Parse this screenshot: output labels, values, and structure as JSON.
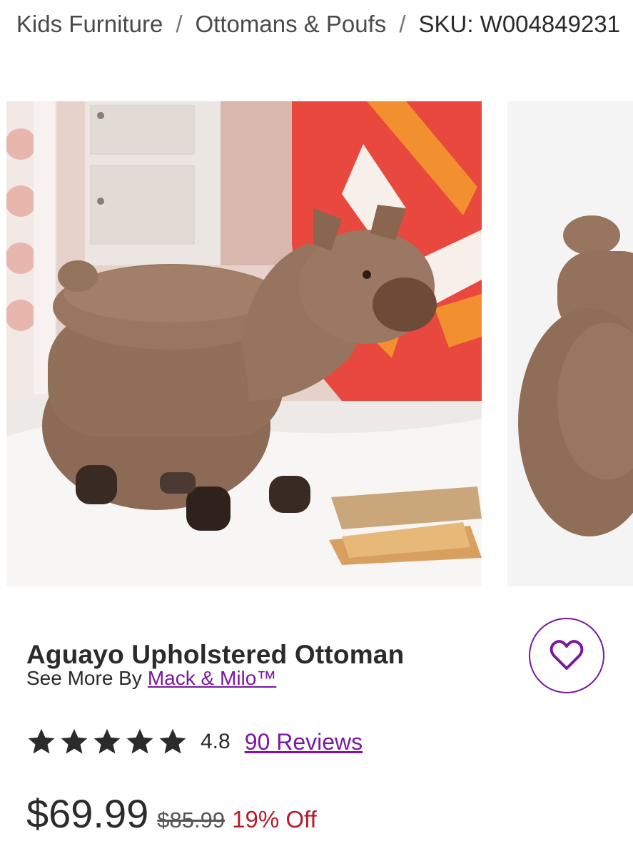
{
  "breadcrumb": {
    "items": [
      {
        "label": "Kids Furniture"
      },
      {
        "label": "Ottomans & Poufs"
      },
      {
        "label": "SKU: W004849231"
      }
    ],
    "separator": "/"
  },
  "product": {
    "title": "Aguayo Upholstered Ottoman",
    "see_more_prefix": "See More By",
    "brand": "Mack & Milo™",
    "rating": "4.8",
    "reviews_label": "90 Reviews",
    "stars_filled": 5,
    "price": "$69.99",
    "original_price": "$85.99",
    "discount": "19% Off"
  },
  "colors": {
    "accent": "#7b189f",
    "sale": "#b51c2b",
    "text": "#2b2b2b"
  },
  "icons": {
    "favorite": "heart-icon",
    "rating": "star-icon"
  }
}
